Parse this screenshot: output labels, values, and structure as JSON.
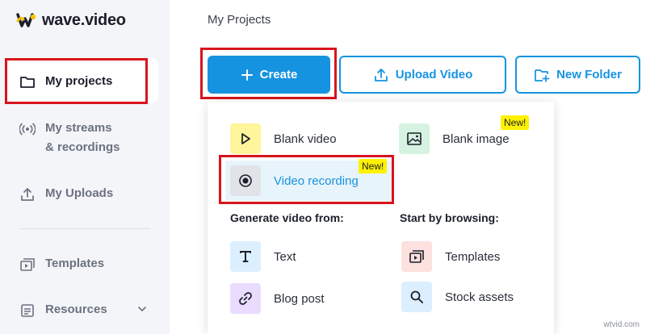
{
  "brand": {
    "name": "wave.video"
  },
  "sidebar": {
    "items": [
      {
        "label": "My projects",
        "icon": "folder-icon",
        "active": true
      },
      {
        "label": "My streams\n& recordings",
        "icon": "broadcast-icon"
      },
      {
        "label": "My Uploads",
        "icon": "upload-icon"
      },
      {
        "label": "Templates",
        "icon": "templates-icon"
      },
      {
        "label": "Resources",
        "icon": "document-icon"
      }
    ]
  },
  "header": {
    "breadcrumb": "My Projects",
    "create_label": "Create",
    "upload_label": "Upload Video",
    "new_folder_label": "New Folder"
  },
  "dropdown": {
    "blank_video": "Blank video",
    "blank_image": "Blank image",
    "video_recording": "Video recording",
    "new_badge": "New!",
    "generate_title": "Generate video from:",
    "browse_title": "Start by browsing:",
    "text": "Text",
    "blog_post": "Blog post",
    "templates": "Templates",
    "stock_assets": "Stock assets"
  },
  "watermark": "wtvid.com",
  "colors": {
    "accent": "#1693e0",
    "highlight": "#d8141c",
    "badge": "#fff200"
  }
}
